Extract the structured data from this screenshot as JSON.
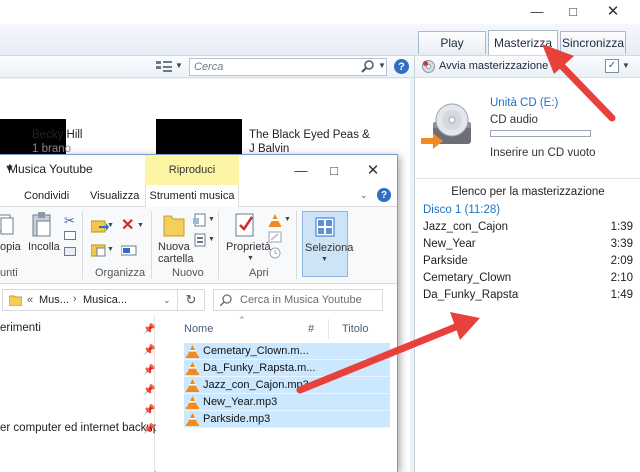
{
  "wmp": {
    "tabs": {
      "play": "Play",
      "burn": "Masterizza",
      "sync": "Sincronizza"
    },
    "search_placeholder": "Cerca",
    "albums": [
      {
        "title": "Becky Hill",
        "subtitle": "1 brano"
      },
      {
        "title": "The Black Eyed Peas &",
        "title2": "J Balvin"
      }
    ],
    "burn": {
      "start_label": "Avvia masterizzazione",
      "drive": "Unità CD (E:)",
      "disc_type": "CD audio",
      "insert_msg": "Inserire un CD vuoto",
      "list_title": "Elenco per la masterizzazione",
      "disc_label": "Disco 1 (11:28)",
      "tracks": [
        {
          "name": "Jazz_con_Cajon",
          "duration": "1:39"
        },
        {
          "name": "New_Year",
          "duration": "3:39"
        },
        {
          "name": "Parkside",
          "duration": "2:09"
        },
        {
          "name": "Cemetary_Clown",
          "duration": "2:10"
        },
        {
          "name": "Da_Funky_Rapsta",
          "duration": "1:49"
        }
      ]
    }
  },
  "explorer": {
    "title": "Musica Youtube",
    "context_tab": "Riproduci",
    "tabs": {
      "share": "Condividi",
      "view": "Visualizza",
      "music_tools": "Strumenti musica"
    },
    "ribbon": {
      "copy": "opia",
      "paste": "Incolla",
      "new_folder_1": "Nuova",
      "new_folder_2": "cartella",
      "properties": "Proprietà",
      "select": "Seleziona",
      "group_clipboard": "unti",
      "group_organize": "Organizza",
      "group_new": "Nuovo",
      "group_open": "Apri"
    },
    "address": {
      "part1": "Mus...",
      "part2": "Musica...",
      "sep": "«"
    },
    "search_placeholder": "Cerca in Musica Youtube",
    "columns": {
      "name": "Nome",
      "number": "#",
      "title": "Titolo"
    },
    "nav_items": [
      "erimenti",
      "er computer ed internet backup"
    ],
    "files": [
      "Cemetary_Clown.m...",
      "Da_Funky_Rapsta.m...",
      "Jazz_con_Cajon.mp3",
      "New_Year.mp3",
      "Parkside.mp3"
    ]
  },
  "colors": {
    "accent_blue": "#1a73c7",
    "annotation_red": "#e8413b",
    "selection": "#cce8ff",
    "context_yellow": "#fdf5a6"
  }
}
